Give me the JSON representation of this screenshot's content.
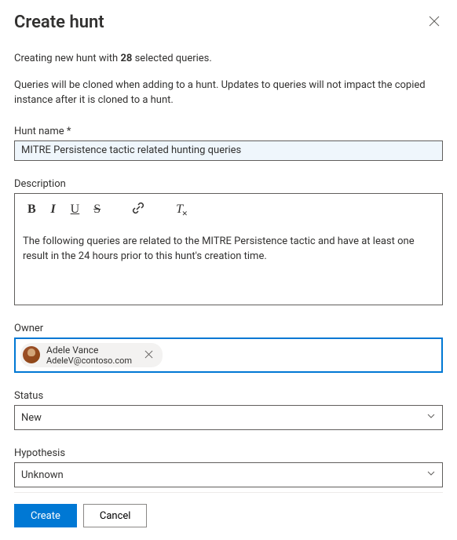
{
  "header": {
    "title": "Create hunt"
  },
  "intro": {
    "prefix": "Creating new hunt with ",
    "count": "28",
    "suffix": " selected queries."
  },
  "note": "Queries will be cloned when adding to a hunt. Updates to queries will not impact the copied instance after it is cloned to a hunt.",
  "fields": {
    "hunt_name": {
      "label": "Hunt name",
      "required_mark": "*",
      "value": "MITRE Persistence tactic related hunting queries"
    },
    "description": {
      "label": "Description",
      "content": "The following queries are related to the MITRE Persistence tactic and have at least one result in the 24 hours prior to this hunt's creation time."
    },
    "owner": {
      "label": "Owner",
      "person": {
        "name": "Adele Vance",
        "email": "AdeleV@contoso.com"
      }
    },
    "status": {
      "label": "Status",
      "value": "New"
    },
    "hypothesis": {
      "label": "Hypothesis",
      "value": "Unknown"
    }
  },
  "footer": {
    "create": "Create",
    "cancel": "Cancel"
  }
}
